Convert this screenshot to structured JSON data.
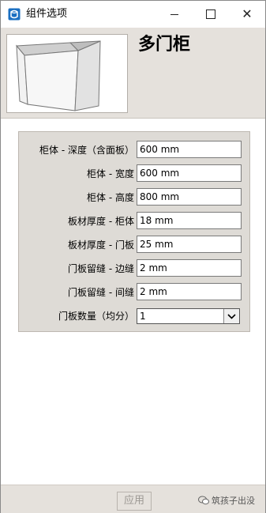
{
  "window": {
    "title": "组件选项"
  },
  "header": {
    "title": "多门柜"
  },
  "form": {
    "rows": [
      {
        "label": "柜体 - 深度（含面板）",
        "value": "600 mm"
      },
      {
        "label": "柜体 - 宽度",
        "value": "600 mm"
      },
      {
        "label": "柜体 - 高度",
        "value": "800 mm"
      },
      {
        "label": "板材厚度 - 柜体",
        "value": "18 mm"
      },
      {
        "label": "板材厚度 - 门板",
        "value": "25 mm"
      },
      {
        "label": "门板留缝 - 边缝",
        "value": "2 mm"
      },
      {
        "label": "门板留缝 - 间缝",
        "value": "2 mm"
      }
    ],
    "door_count": {
      "label": "门板数量（均分）",
      "selected": "1"
    }
  },
  "footer": {
    "apply_label": "应用",
    "watermark": "筑孩子出没"
  },
  "icons": {
    "app": "sketchup-logo-icon",
    "minimize": "minimize-icon",
    "maximize": "maximize-icon",
    "close": "close-icon",
    "dropdown": "chevron-down-icon"
  },
  "colors": {
    "header_bg": "#e5e1dc",
    "panel_bg": "#dedbd6",
    "disabled_text": "#9c9893"
  }
}
